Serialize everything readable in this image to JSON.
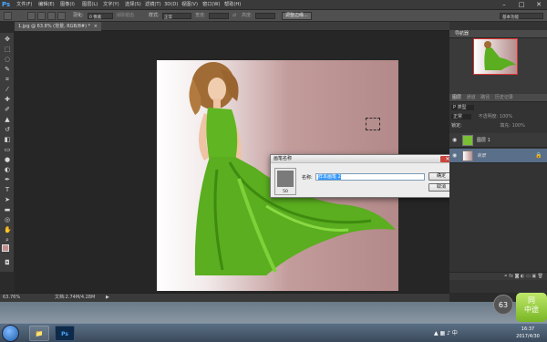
{
  "app": {
    "logo": "Ps"
  },
  "menubar": {
    "items": [
      "文件(F)",
      "编辑(E)",
      "图像(I)",
      "图层(L)",
      "文字(Y)",
      "选择(S)",
      "滤镜(T)",
      "3D(D)",
      "视图(V)",
      "窗口(W)",
      "帮助(H)"
    ],
    "minimize": "–",
    "maximize": "□",
    "close": "✕"
  },
  "options": {
    "feather_label": "羽化:",
    "feather_value": "0 像素",
    "antialias": "消除锯齿",
    "style_label": "样式:",
    "style_value": "正常",
    "width_label": "宽度:",
    "height_label": "高度:",
    "adjust_edge": "调整边缘...",
    "workspace": "基本功能"
  },
  "document": {
    "tab": "1.jpg @ 63.8% (背景, RGB/8#) *",
    "tab_close": "×"
  },
  "dialog": {
    "title": "画笔名称",
    "close": "✕",
    "preview_size": "50",
    "name_label": "名称:",
    "name_value": "样本画笔 2",
    "ok": "确定",
    "cancel": "取消"
  },
  "navigator": {
    "tab": "导航器"
  },
  "layers_panel": {
    "tabs": [
      "图层",
      "通道",
      "路径",
      "历史记录"
    ],
    "kind_label": "P 类型",
    "blend_mode": "正常",
    "opacity_label": "不透明度:",
    "opacity_value": "100%",
    "lock_label": "锁定:",
    "fill_label": "填充:",
    "fill_value": "100%",
    "layers": [
      {
        "name": "图层 1"
      },
      {
        "name": "背景"
      }
    ]
  },
  "status": {
    "zoom": "63.76%",
    "doc_info": "文档:2.74M/4.28M"
  },
  "taskbar": {
    "time": "16:37",
    "date": "2017/4/30",
    "badge": "63",
    "tile_text": "同\n中途"
  },
  "colors": {
    "accent": "#4aa8ff",
    "dress_green": "#5fb622",
    "bg_mauve": "#b38989"
  }
}
